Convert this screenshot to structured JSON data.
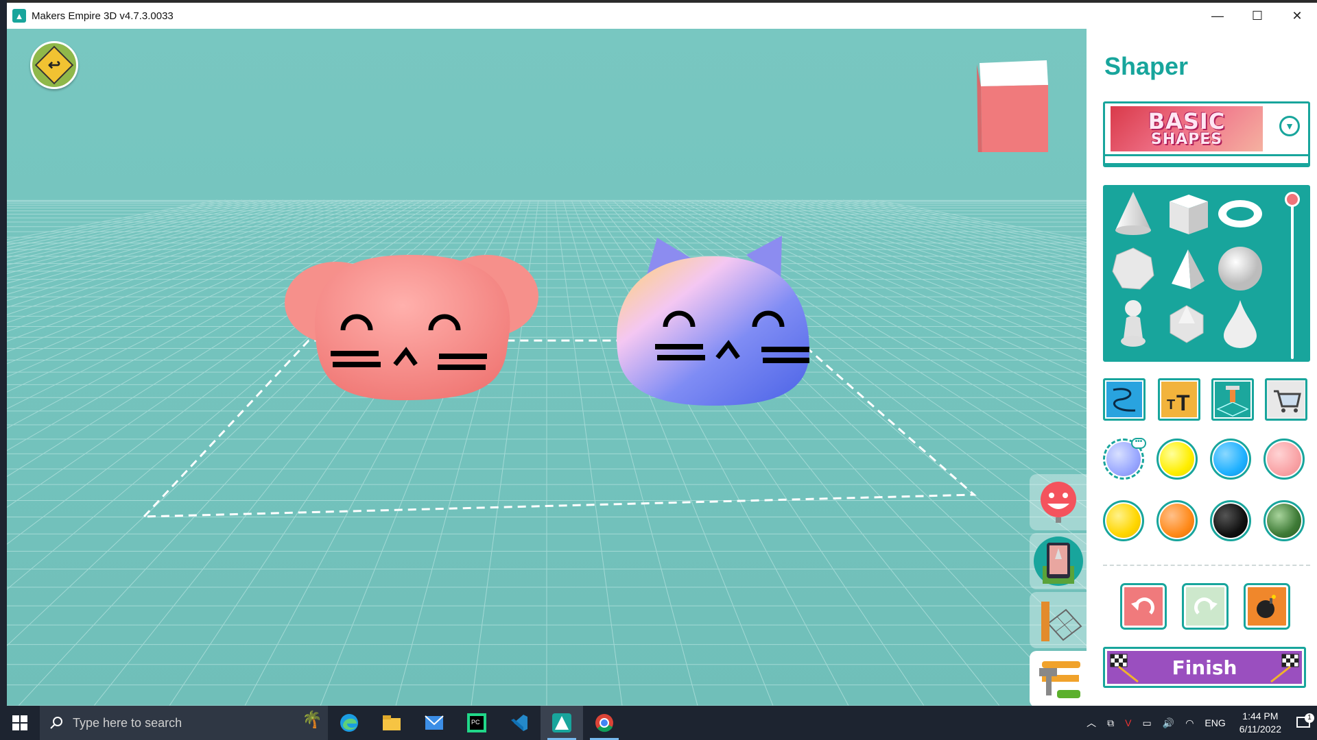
{
  "window": {
    "title": "Makers Empire 3D v4.7.3.0033",
    "minimize": "—",
    "maximize": "☐",
    "close": "✕"
  },
  "viewport": {
    "back_icon": "undo-arrow-icon",
    "view_cube_color": "#f07a7c",
    "dock_tools": [
      "emoji-stamp-icon",
      "rocket-tablet-icon",
      "ruler-grid-icon",
      "build-tools-icon"
    ]
  },
  "panel": {
    "title": "Shaper",
    "library": {
      "line1": "BASIC",
      "line2": "SHAPES"
    },
    "shapes": [
      "cone",
      "cube",
      "torus",
      "dodecahedron",
      "pyramid",
      "sphere",
      "pawn",
      "icosahedron",
      "drop"
    ],
    "tools": [
      "squiggle-draw-icon",
      "text-tool-icon",
      "terrain-tool-icon",
      "shop-cart-icon"
    ],
    "colors": [
      "#9aa8ff",
      "#ffee00",
      "#1fb0ff",
      "#f9a3a6",
      "#ffd600",
      "#ff8a1a",
      "#111111",
      "#3e7a36"
    ],
    "selected_color_more": "•••",
    "finish_label": "Finish"
  },
  "taskbar": {
    "search_placeholder": "Type here to search",
    "apps": [
      "edge",
      "file-explorer",
      "mail",
      "pycharm",
      "vscode",
      "makers-empire",
      "chrome"
    ],
    "language": "ENG",
    "time": "1:44 PM",
    "date": "6/11/2022",
    "notification_count": "1"
  }
}
